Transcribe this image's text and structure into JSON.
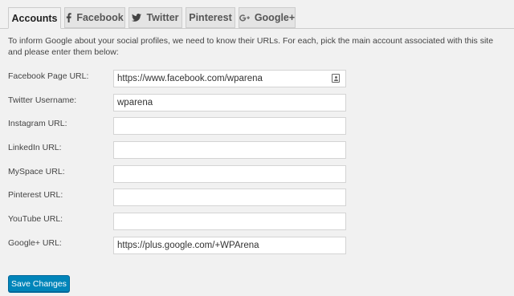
{
  "tabs": [
    {
      "label": "Accounts",
      "icon": "",
      "active": true
    },
    {
      "label": "Facebook",
      "icon": "facebook-icon",
      "active": false
    },
    {
      "label": "Twitter",
      "icon": "twitter-icon",
      "active": false
    },
    {
      "label": "Pinterest",
      "icon": "",
      "active": false
    },
    {
      "label": "Google+",
      "icon": "google-plus-icon",
      "active": false
    }
  ],
  "intro": "To inform Google about your social profiles, we need to know their URLs. For each, pick the main account associated with this site and please enter them below:",
  "fields": [
    {
      "label": "Facebook Page URL:",
      "value": "https://www.facebook.com/wparena"
    },
    {
      "label": "Twitter Username:",
      "value": "wparena"
    },
    {
      "label": "Instagram URL:",
      "value": ""
    },
    {
      "label": "LinkedIn URL:",
      "value": ""
    },
    {
      "label": "MySpace URL:",
      "value": ""
    },
    {
      "label": "Pinterest URL:",
      "value": ""
    },
    {
      "label": "YouTube URL:",
      "value": ""
    },
    {
      "label": "Google+ URL:",
      "value": "https://plus.google.com/+WPArena"
    }
  ],
  "save_label": "Save Changes",
  "colors": {
    "background": "#f1f1f1",
    "primary_button": "#0085ba",
    "primary_button_border": "#006799"
  }
}
